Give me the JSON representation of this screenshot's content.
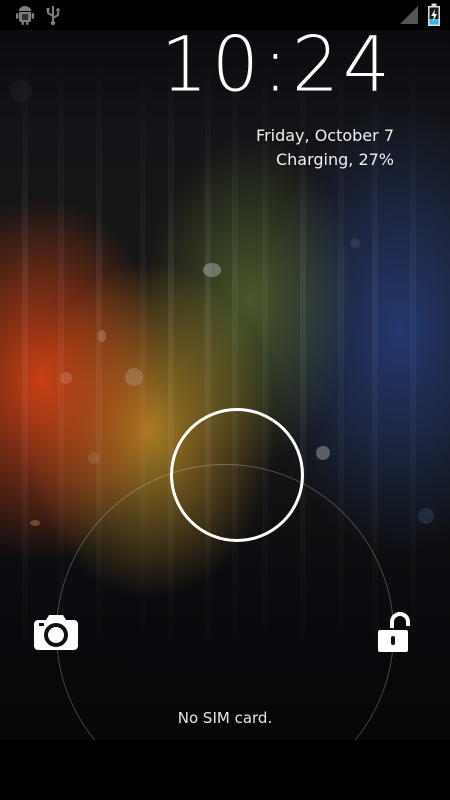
{
  "status_bar": {
    "left_icons": [
      "android-debug-icon",
      "usb-icon"
    ],
    "right_icons": [
      "signal-icon",
      "battery-charging-icon"
    ],
    "battery_level": 0.27
  },
  "lockscreen": {
    "time": "10:24",
    "date": "Friday, October 7",
    "charging_status": "Charging, 27%",
    "carrier_text": "No SIM card.",
    "targets": {
      "camera_icon": "camera-icon",
      "unlock_icon": "unlock-icon"
    }
  }
}
